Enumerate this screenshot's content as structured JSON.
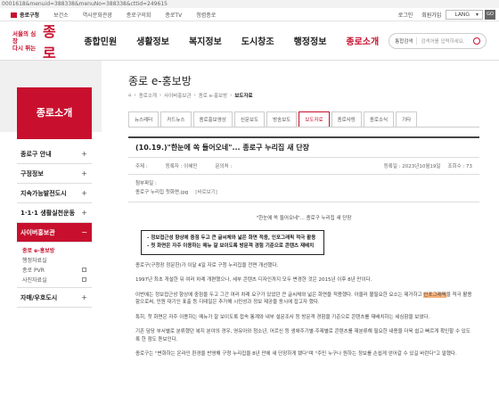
{
  "url": "0001618&menuid=388338&menuNo=388338&cttid=249615",
  "topbar": {
    "links": [
      "종로구청",
      "보건소",
      "역사문화관광",
      "종로구의회",
      "종로TV",
      "청렴종로"
    ],
    "login": "로그인",
    "join": "회원가입",
    "lang": "LANG",
    "go": "GO"
  },
  "logo": {
    "slogan_1": "서울의 심장",
    "slogan_2": "다시 뛰는",
    "name": "종로"
  },
  "gnb": [
    "종합민원",
    "생활정보",
    "복지정보",
    "도시창조",
    "행정정보",
    "종로소개"
  ],
  "search": {
    "scope": "통합검색",
    "placeholder": "검색어를 입력하세요."
  },
  "lnb": {
    "title": "종로소개",
    "items": [
      {
        "label": "종로구 안내"
      },
      {
        "label": "구정정보"
      },
      {
        "label": "지속가능발전도시"
      },
      {
        "label": "1·1·1 생활실천운동"
      },
      {
        "label": "사이버홍보관"
      },
      {
        "label": "자매/우호도시"
      }
    ],
    "sub": [
      "종로 e-홍보방",
      "행정자료실",
      "종로 PVR",
      "사진자료실"
    ]
  },
  "page": {
    "title": "종로 e-홍보방",
    "breadcrumb": [
      "종로소개",
      "사이버홍보관",
      "종로 e-홍보방",
      "보도자료"
    ]
  },
  "tabs": [
    "뉴스레터",
    "카드뉴스",
    "종로홍보영상",
    "신문보도",
    "방송보도",
    "보도자료",
    "종로사랑",
    "종로소식",
    "기타"
  ],
  "post": {
    "title": "(10.19.)\"한눈에 쏙 들어오네\"... 종로구 누리집 새 단장",
    "writer_label": "주제 :",
    "dept": "등록자 : 이혜민",
    "phone": "문의처 :",
    "date": "등록일 : 2023년10월19일",
    "views": "조회수 : 73",
    "attach_label": "첨부파일 :",
    "attach_file": "종로구 누리집 첫화면.jpg",
    "attach_btn": "[바로보기]",
    "subtitle": "\"한눈에 쏙 들어오네\"... 종로구 누리집 새 단장",
    "box_1": "- 정보접근성 향상에 중점 두고 큰 글씨체와 넓은 화면 적용, 인포그래픽 적극 활용",
    "box_2": "- 첫 화면은 자주 이용하는 메뉴 잘 보이도록 방문객 경험 기준으로 콘텐츠 재배치",
    "p1": "종로구(구청장 정문헌)가 이달 4일 자로 구청 누리집을 전면 개선했다.",
    "p2": "1997년 최초 개설한 뒤 여러 차례 개편했으나, 세부 콘텐츠 디자인까지 모두 변경한 것은 2015년 이후 8년 만이다.",
    "p3a": "이번에는 정보접근성 향상에 중점을 두고 그간 여러 차례 요구가 있었던 큰 글씨체와 넓은 화면을 적용했다. 아울러 불필요한 요소는 제거하고 ",
    "p3_hl": "인포그래픽",
    "p3b": "을 적극 활용함으로써, 민원 대기인 표출 등 디테일은 추가해 시민성과 정보 제공을 동시에 잡고자 했다.",
    "p4": "특히, 첫 화면은 자주 이용하는 메뉴가 잘 보이도록 접속 통계와 내부 설문조사 등 방문객 경험을 기준으로 콘텐츠를 재배치하는 세심함을 보였다.",
    "p5": "기존 담당 부서별로 분류했던 복지 분야의 경우, 영유아와 청소년, 어르신 등 생애주기별·주제별로 콘텐츠를 재분류해 필요한 내용을 더욱 쉽고 빠르게 확인할 수 있도록 한 점도 돋보인다.",
    "p6": "종로구는 \"변화하는 온라인 환경을 반영해 구청 누리집을 8년 만에 새 단장하게 됐다\"며 \"주민 누구나 원하는 정보를 손쉽게 얻어갈 수 있길 바란다\"고 말했다."
  }
}
